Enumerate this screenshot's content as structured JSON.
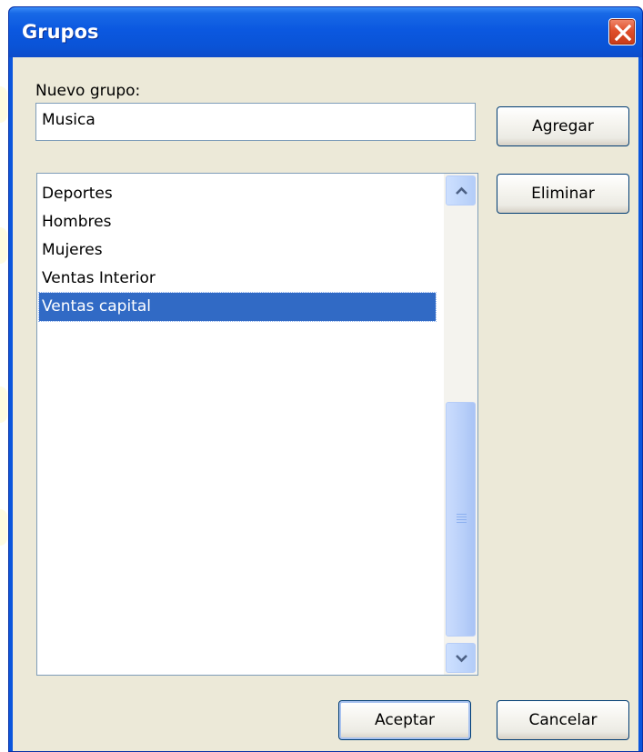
{
  "window": {
    "title": "Grupos"
  },
  "new_group": {
    "label": "Nuevo grupo:",
    "value": "Musica"
  },
  "buttons": {
    "add": "Agregar",
    "delete": "Eliminar",
    "ok": "Aceptar",
    "cancel": "Cancelar"
  },
  "groups": {
    "items": [
      "Deportes",
      "Hombres",
      "Mujeres",
      "Ventas Interior",
      "Ventas capital"
    ],
    "selected": "Ventas capital"
  },
  "icons": {
    "close": "close-icon",
    "scroll_up": "chevron-up-icon",
    "scroll_down": "chevron-down-icon",
    "scroll_grip": "grip-icon"
  },
  "colors": {
    "titlebar": "#0b58e0",
    "selection": "#316ac5",
    "dialog_face": "#ece9d8"
  }
}
